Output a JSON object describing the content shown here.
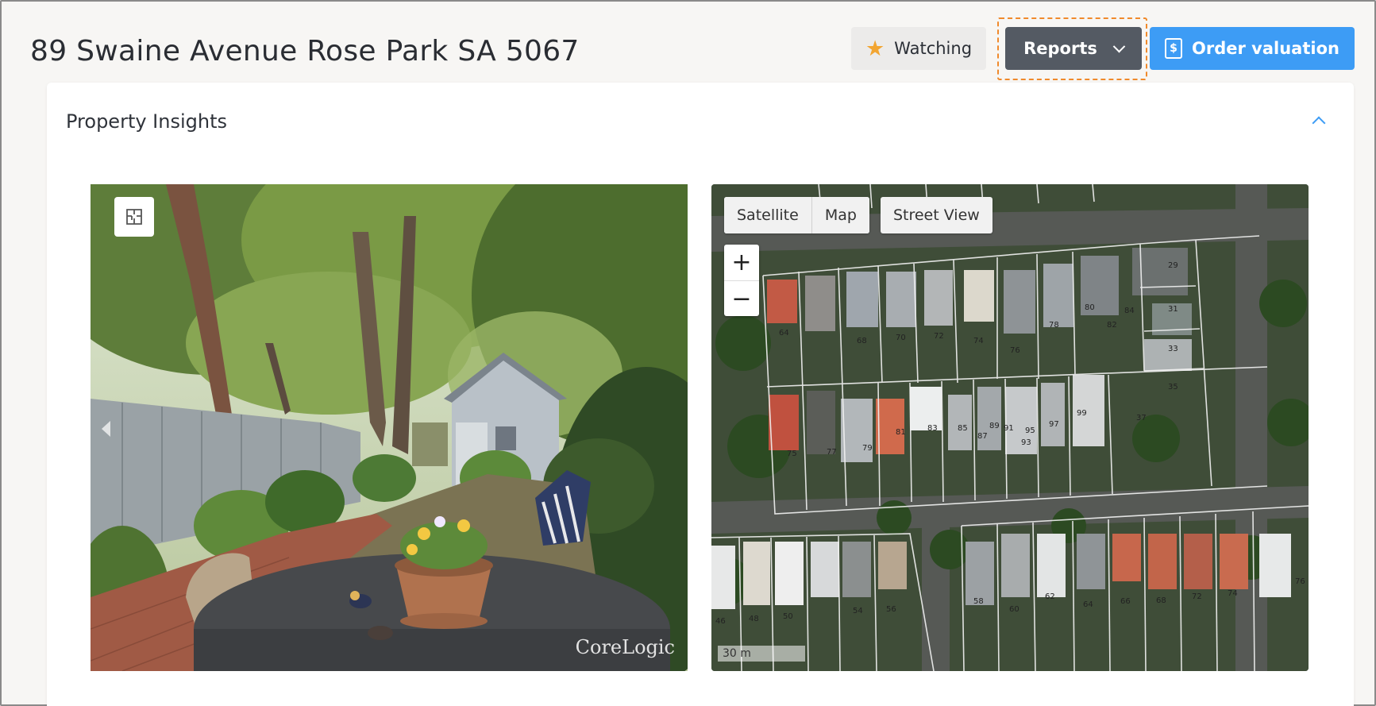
{
  "header": {
    "title": "89 Swaine Avenue Rose Park SA 5067",
    "watching_label": "Watching",
    "reports_label": "Reports",
    "order_label": "Order valuation",
    "order_icon_glyph": "$"
  },
  "icons": {
    "watching": "star-icon",
    "reports": "chevron-down-icon",
    "order": "document-dollar-icon",
    "collapse": "chevron-up-icon",
    "floorplan": "floorplan-icon",
    "prev": "arrow-left-icon"
  },
  "colors": {
    "accent": "#3d9cf5",
    "reports_bg": "#545a63",
    "star": "#f2a531",
    "focus_outline": "#f08a2c"
  },
  "insights": {
    "title": "Property Insights",
    "photo_watermark": "CoreLogic"
  },
  "map": {
    "view_options": [
      "Satellite",
      "Map"
    ],
    "street_view_label": "Street View",
    "zoom_in": "+",
    "zoom_out": "−",
    "scale": "30 m",
    "lot_numbers": [
      "29",
      "31",
      "33",
      "35",
      "37",
      "64",
      "68",
      "70",
      "72",
      "74",
      "76",
      "78",
      "80",
      "82",
      "84",
      "75",
      "77",
      "79",
      "81",
      "83",
      "85",
      "87",
      "89",
      "91",
      "93",
      "95",
      "97",
      "99",
      "46",
      "48",
      "50",
      "54",
      "56",
      "58",
      "60",
      "62",
      "64",
      "66",
      "68",
      "72",
      "74",
      "76"
    ]
  }
}
